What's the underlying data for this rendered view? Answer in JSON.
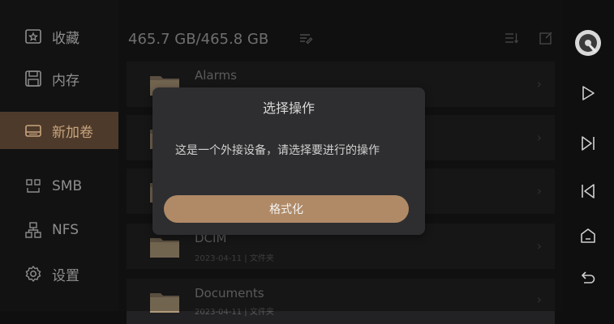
{
  "sidebar": {
    "items": [
      {
        "label": "收藏",
        "icon": "star-icon"
      },
      {
        "label": "内存",
        "icon": "save-icon"
      },
      {
        "label": "新加卷",
        "icon": "drive-icon"
      },
      {
        "label": "SMB",
        "icon": "smb-icon"
      },
      {
        "label": "NFS",
        "icon": "network-icon"
      },
      {
        "label": "设置",
        "icon": "gear-icon"
      }
    ],
    "active_index": 2,
    "accent": "#c7a47f"
  },
  "header": {
    "storage": "465.7 GB/465.8 GB"
  },
  "files": [
    {
      "name": "Alarms",
      "meta": ""
    },
    {
      "name": "",
      "meta": ""
    },
    {
      "name": "",
      "meta": ""
    },
    {
      "name": "DCIM",
      "meta": "2023-04-11 | 文件夹"
    },
    {
      "name": "Documents",
      "meta": "2023-04-11 | 文件夹"
    }
  ],
  "dialog": {
    "title": "选择操作",
    "message": "这是一个外接设备，请选择要进行的操作",
    "button": "格式化",
    "button_color": "#b08a66"
  },
  "rightbar": {
    "icons": [
      "disc-icon",
      "play-icon",
      "skip-next-icon",
      "skip-previous-icon",
      "home-icon",
      "back-icon"
    ]
  }
}
